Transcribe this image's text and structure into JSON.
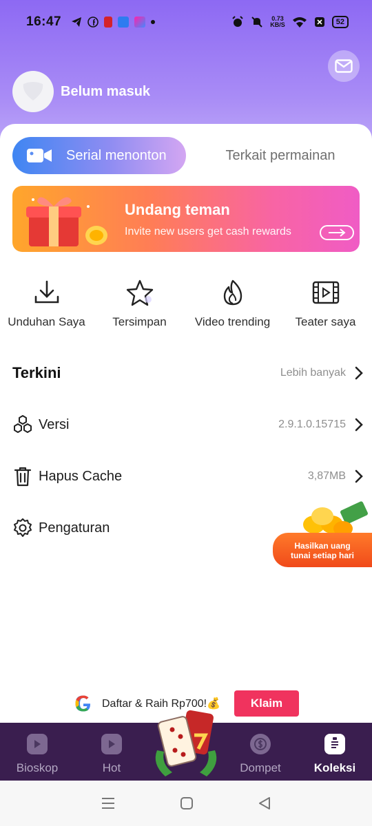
{
  "status_bar": {
    "time": "16:47",
    "network_speed_value": "0.73",
    "network_speed_unit": "KB/S",
    "battery": "52"
  },
  "profile": {
    "name": "Belum masuk"
  },
  "tabs": {
    "active_label": "Serial menonton",
    "inactive_label": "Terkait permainan"
  },
  "banner": {
    "title": "Undang teman",
    "subtitle": "Invite new users get cash rewards"
  },
  "shortcuts": [
    {
      "label": "Unduhan Saya",
      "icon": "download-icon"
    },
    {
      "label": "Tersimpan",
      "icon": "star-icon"
    },
    {
      "label": "Video trending",
      "icon": "flame-icon"
    },
    {
      "label": "Teater saya",
      "icon": "film-icon"
    }
  ],
  "recent": {
    "title": "Terkini",
    "more_label": "Lebih banyak"
  },
  "menu": {
    "version_label": "Versi",
    "version_value": "2.9.1.0.15715",
    "cache_label": "Hapus Cache",
    "cache_value": "3,87MB",
    "settings_label": "Pengaturan"
  },
  "promo": {
    "line1": "Hasilkan uang",
    "line2": "tunai setiap hari"
  },
  "ad": {
    "text": "Daftar & Raih Rp700!💰",
    "button": "Klaim"
  },
  "bottom_nav": [
    {
      "label": "Bioskop",
      "icon": "play-icon",
      "active": false
    },
    {
      "label": "Hot",
      "icon": "play-icon",
      "active": false
    },
    {
      "label": "Dompet",
      "icon": "coin-icon",
      "active": false
    },
    {
      "label": "Koleksi",
      "icon": "clipboard-icon",
      "active": true
    }
  ],
  "colors": {
    "header_top": "#8d69f3",
    "nav_bg": "#3a1e4f",
    "ad_button": "#f0335e"
  }
}
